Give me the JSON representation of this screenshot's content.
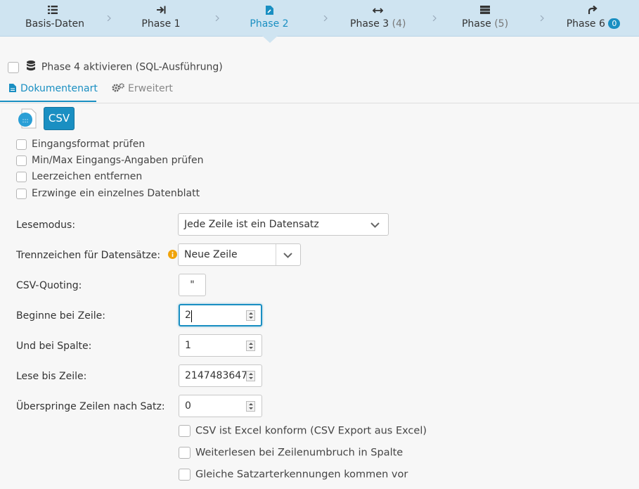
{
  "wizard": {
    "steps": [
      {
        "label": "Basis-Daten",
        "count": "",
        "icon": "list-icon"
      },
      {
        "label": "Phase 1",
        "count": "",
        "icon": "arrow-to-right-icon"
      },
      {
        "label": "Phase 2",
        "count": "",
        "icon": "file-edit-icon",
        "active": true
      },
      {
        "label": "Phase 3",
        "count": "(4)",
        "icon": "arrows-horizontal-icon"
      },
      {
        "label": "Phase",
        "count": "(5)",
        "icon": "server-icon"
      },
      {
        "label": "Phase 6",
        "count": "",
        "badge": "0",
        "icon": "share-arrow-icon"
      }
    ]
  },
  "phase4": {
    "label": "Phase 4 aktivieren (SQL-Ausführung)",
    "icon": "database-icon"
  },
  "tabs": [
    {
      "label": "Dokumentenart",
      "icon": "file-icon",
      "active": true
    },
    {
      "label": "Erweitert",
      "icon": "gears-icon"
    }
  ],
  "doctype": {
    "csv_button": "CSV",
    "icon": "csv-file-icon"
  },
  "checks": [
    "Eingangsformat prüfen",
    "Min/Max Eingangs-Angaben prüfen",
    "Leerzeichen entfernen",
    "Erzwinge ein einzelnes Datenblatt"
  ],
  "fields": {
    "lesemodus": {
      "label": "Lesemodus:",
      "value": "Jede Zeile ist ein Datensatz"
    },
    "trennzeichen": {
      "label": "Trennzeichen für Datensätze:",
      "value": "Neue Zeile",
      "info_icon": "info-icon"
    },
    "quoting": {
      "label": "CSV-Quoting:",
      "value": "\""
    },
    "beginne_zeile": {
      "label": "Beginne bei Zeile:",
      "value": "2"
    },
    "spalte": {
      "label": "Und bei Spalte:",
      "value": "1"
    },
    "lese_bis": {
      "label": "Lese bis Zeile:",
      "value": "2147483647"
    },
    "ueberspringe": {
      "label": "Überspringe Zeilen nach Satz:",
      "value": "0"
    }
  },
  "bottom_checks": [
    "CSV ist Excel konform (CSV Export aus Excel)",
    "Weiterlesen bei Zeilenumbruch in Spalte",
    "Gleiche Satzarterkennungen kommen vor"
  ],
  "colors": {
    "accent": "#1a8fc2",
    "wizard_bg": "#cfe4f1",
    "info": "#f0a30a"
  }
}
